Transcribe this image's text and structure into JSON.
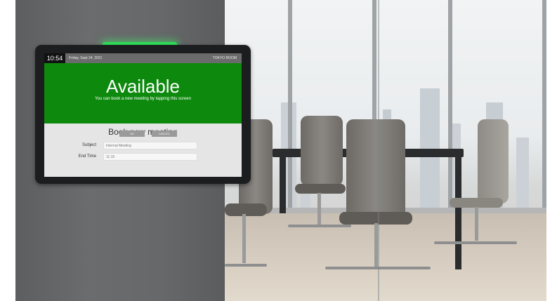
{
  "statusbar": {
    "time": "10:54",
    "date": "Friday, Sept 24, 2021",
    "room": "TOKYO ROOM"
  },
  "status": {
    "title": "Available",
    "subtitle": "You can book a new meeting by tapping this screen",
    "color": "#0d8a0d"
  },
  "form": {
    "title": "Book new meeting",
    "subject_label": "Subject",
    "subject_placeholder": "Internal Meeting",
    "end_time_label": "End Time",
    "end_time_placeholder": "11:15",
    "ok_label": "OK",
    "cancel_label": "CANCEL"
  },
  "device": {
    "indicator_color": "#2fe05a"
  }
}
